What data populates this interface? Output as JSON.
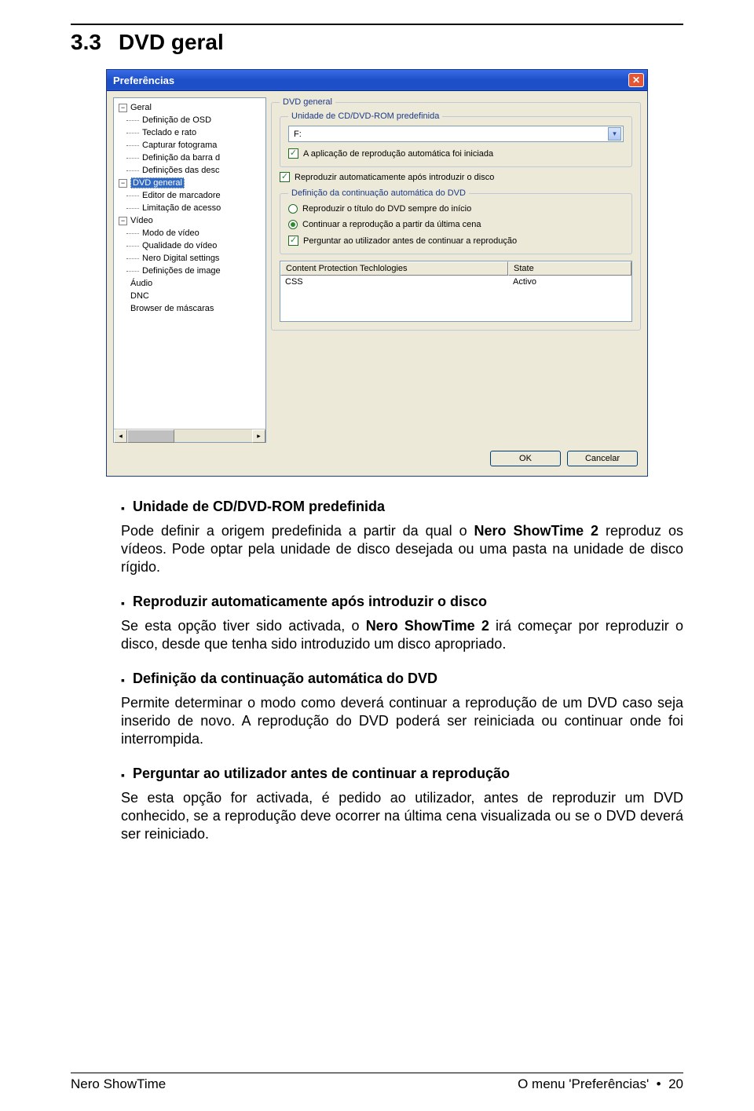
{
  "section": {
    "num": "3.3",
    "title": "DVD geral"
  },
  "dialog": {
    "title": "Preferências",
    "tree": {
      "geral": {
        "label": "Geral",
        "expanded": true,
        "children": [
          "Definição de OSD",
          "Teclado e rato",
          "Capturar fotograma",
          "Definição da barra d",
          "Definições das desc"
        ]
      },
      "dvd": {
        "label": "DVD general",
        "expanded": true,
        "selected": true,
        "children": [
          "Editor de marcadore",
          "Limitação de acesso"
        ]
      },
      "video": {
        "label": "Vídeo",
        "expanded": true,
        "children": [
          "Modo de vídeo",
          "Qualidade do vídeo",
          "Nero Digital settings",
          "Definições de image"
        ]
      },
      "plain": [
        "Áudio",
        "DNC",
        "Browser de máscaras"
      ]
    },
    "dvd_general_legend": "DVD general",
    "drive": {
      "legend": "Unidade de CD/DVD-ROM predefinida",
      "value": "F:",
      "cb_app": "A aplicação de reprodução automática foi iniciada"
    },
    "cb_autoplay": "Reproduzir automaticamente após introduzir o disco",
    "resume": {
      "legend": "Definição da continuação automática do DVD",
      "r1": "Reproduzir o título do DVD sempre do início",
      "r2": "Continuar a reprodução a partir da última cena",
      "cb_ask": "Perguntar ao utilizador antes de continuar a reprodução"
    },
    "table": {
      "h1": "Content Protection Techlologies",
      "h2": "State",
      "c1": "CSS",
      "c2": "Activo"
    },
    "ok": "OK",
    "cancel": "Cancelar"
  },
  "items": [
    {
      "title": "Unidade de CD/DVD-ROM predefinida",
      "text": "Pode definir a origem predefinida a partir da qual o <b>Nero ShowTime 2</b> reproduz os vídeos. Pode optar pela unidade de disco desejada ou uma pasta na unidade de disco rígido."
    },
    {
      "title": "Reproduzir  automaticamente após introduzir o disco",
      "text": "Se esta opção tiver sido activada, o <b>Nero ShowTime 2</b> irá começar por reproduzir o disco, desde que tenha sido introduzido um disco apropriado."
    },
    {
      "title": "Definição da continuação automática do DVD",
      "text": "Permite determinar o modo como deverá continuar a reprodução de um DVD caso seja inserido de novo. A reprodução do DVD poderá ser reiniciada ou continuar onde foi interrompida."
    },
    {
      "title": "Perguntar ao utilizador antes de continuar a reprodução",
      "text": "Se esta opção for activada, é pedido ao utilizador, antes de reproduzir um DVD conhecido, se a reprodução deve ocorrer na última cena visualizada ou se o DVD deverá ser reiniciado."
    }
  ],
  "footer": {
    "left": "Nero ShowTime",
    "right_label": "O menu 'Preferências'",
    "bullet": "•",
    "page": "20"
  }
}
